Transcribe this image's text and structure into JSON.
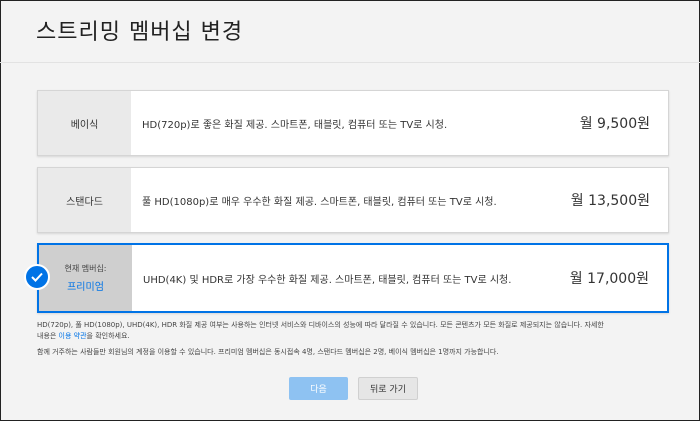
{
  "header": {
    "title": "스트리밍 멤버십 변경"
  },
  "plans": [
    {
      "name": "베이식",
      "description": "HD(720p)로 좋은 화질 제공. 스마트폰, 태블릿, 컴퓨터 또는 TV로 시청.",
      "price": "월 9,500원"
    },
    {
      "name": "스탠다드",
      "description": "풀 HD(1080p)로 매우 우수한 화질 제공. 스마트폰, 태블릿, 컴퓨터 또는 TV로 시청.",
      "price": "월 13,500원"
    },
    {
      "current_label": "현재 멤버십:",
      "name": "프리미엄",
      "description": "UHD(4K) 및 HDR로 가장 우수한 화질 제공. 스마트폰, 태블릿, 컴퓨터 또는 TV로 시청.",
      "price": "월 17,000원"
    }
  ],
  "fine_print": {
    "line1": "HD(720p), 풀 HD(1080p), UHD(4K), HDR 화질 제공 여부는 사용하는 인터넷 서비스와 디바이스의 성능에 따라 달라질 수 있습니다. 모든 콘텐츠가 모든 화질로 제공되지는 않습니다. 자세한",
    "line2_prefix": "내용은 ",
    "terms_link": "이용 약관",
    "line2_suffix": "을 확인하세요.",
    "line3": "함께 거주하는 사람들만 회원님의 계정을 이용할 수 있습니다. 프리미엄 멤버십은 동시접속 4명, 스탠다드 멤버십은 2명, 베이식 멤버십은 1명까지 가능합니다."
  },
  "buttons": {
    "next": "다음",
    "back": "뒤로 가기"
  },
  "colors": {
    "accent": "#0073e6",
    "next_button": "#8ec2f2"
  }
}
